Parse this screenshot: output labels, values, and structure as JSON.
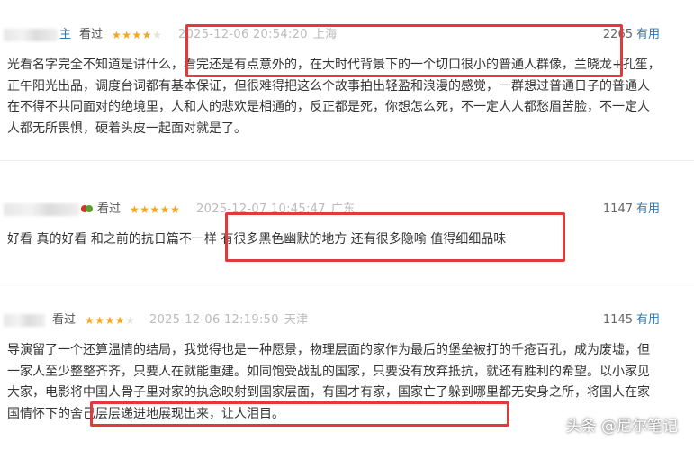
{
  "reviews": [
    {
      "user_tail": "主",
      "seen_label": "看过",
      "stars": 4,
      "time": "2025-12-06 20:54:20",
      "location": "上海",
      "votes": "2265",
      "useful_label": "有用",
      "content": "光看名字完全不知道是讲什么，看完还是有点意外的，在大时代背景下的一个切口很小的普通人群像，兰晓龙+孔笙，正午阳光出品，调度台词都有基本保证，但很难得把这么个故事拍出轻盈和浪漫的感觉，一群想过普通日子的普通人在不得不共同面对的绝境里，人和人的悲欢是相通的，反正都是死，你想怎么死，不一定人人都愁眉苦脸，不一定人人都无所畏惧，硬着头皮一起面对就是了。"
    },
    {
      "user_tail": "",
      "seen_label": "看过",
      "stars": 5,
      "time": "2025-12-07 10:45:47",
      "location": "广东",
      "votes": "1147",
      "useful_label": "有用",
      "content": "好看 真的好看 和之前的抗日篇不一样 有很多黑色幽默的地方 还有很多隐喻 值得细细品味"
    },
    {
      "user_tail": "",
      "seen_label": "看过",
      "stars": 4,
      "time": "2025-12-06 12:19:50",
      "location": "天津",
      "votes": "1145",
      "useful_label": "有用",
      "content": "导演留了一个还算温情的结局，我觉得也是一种愿景，物理层面的家作为最后的堡垒被打的千疮百孔，成为废墟，但一家人至少整整齐齐，只要人在就能重建。如同饱受战乱的国家，只要没有放弃抵抗，就还有胜利的希望。以小家见大家，电影将中国人骨子里对家的执念映射到国家层面，有国才有家，国家亡了躲到哪里都无安身之所，将国人在家国情怀下的舍己层层递进地展现出来，让人泪目。"
    }
  ],
  "watermark": "头条 @尼尔笔记",
  "colors": {
    "highlight": "#e23a3a",
    "star": "#f5a623",
    "link": "#3377aa",
    "time": "#bbbbbb"
  }
}
